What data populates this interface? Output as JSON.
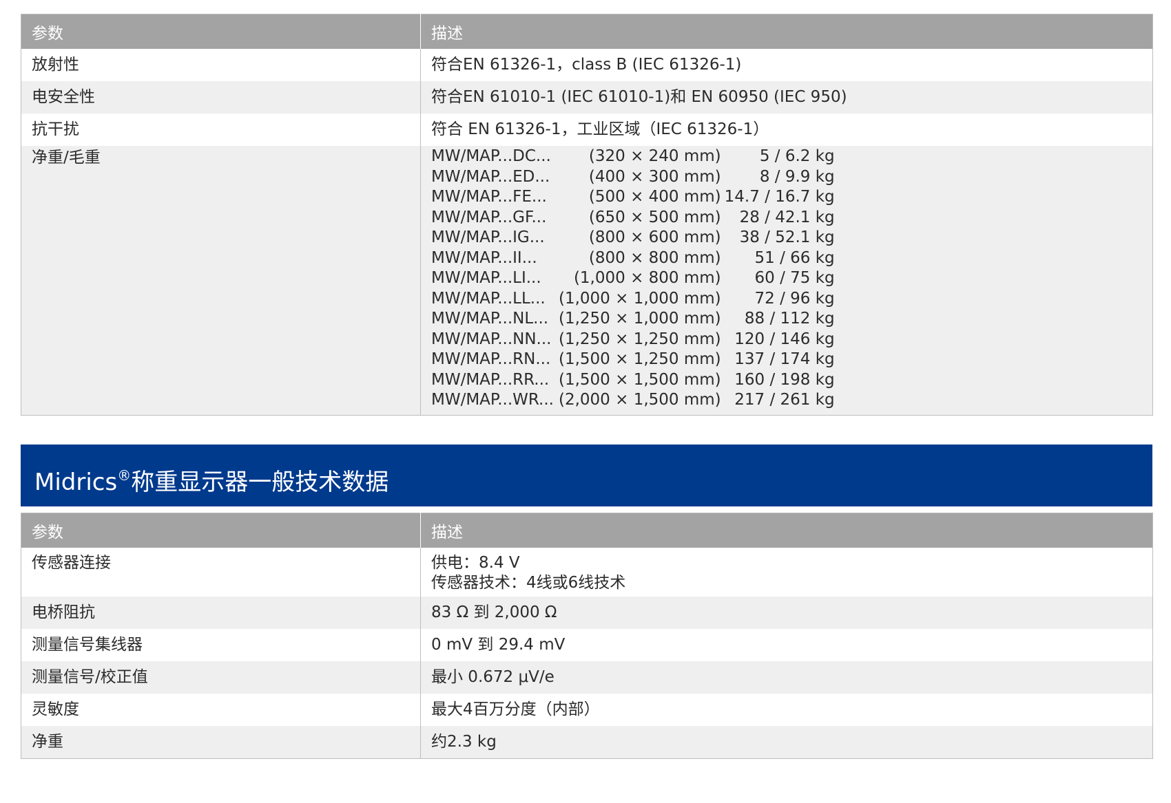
{
  "table1": {
    "headers": {
      "param": "参数",
      "desc": "描述"
    },
    "rows": [
      {
        "param": "放射性",
        "desc": "符合EN 61326-1，class B (IEC 61326-1)"
      },
      {
        "param": "电安全性",
        "desc": "符合EN 61010-1 (IEC 61010-1)和 EN 60950 (IEC 950)"
      },
      {
        "param": "抗干扰",
        "desc": "符合 EN 61326-1，工业区域（IEC 61326-1）"
      },
      {
        "param": "净重/毛重"
      }
    ],
    "weights": [
      {
        "model": "MW/MAP...DC...",
        "dim": "(320 × 240 mm)",
        "weight": "5 / 6.2 kg"
      },
      {
        "model": "MW/MAP...ED...",
        "dim": "(400 × 300 mm)",
        "weight": "8 / 9.9 kg"
      },
      {
        "model": "MW/MAP...FE...",
        "dim": "(500 × 400 mm)",
        "weight": "14.7 / 16.7 kg"
      },
      {
        "model": "MW/MAP...GF...",
        "dim": "(650 × 500 mm)",
        "weight": "28 / 42.1 kg"
      },
      {
        "model": "MW/MAP...IG...",
        "dim": "(800 × 600 mm)",
        "weight": "38 / 52.1 kg"
      },
      {
        "model": "MW/MAP...II...",
        "dim": "(800 × 800 mm)",
        "weight": "51 / 66 kg"
      },
      {
        "model": "MW/MAP...LI...",
        "dim": "(1,000 × 800 mm)",
        "weight": "60 / 75 kg"
      },
      {
        "model": "MW/MAP...LL...",
        "dim": "(1,000 × 1,000 mm)",
        "weight": "72 / 96 kg"
      },
      {
        "model": "MW/MAP...NL...",
        "dim": "(1,250 × 1,000 mm)",
        "weight": "88 / 112 kg"
      },
      {
        "model": "MW/MAP...NN...",
        "dim": "(1,250 × 1,250 mm)",
        "weight": "120 / 146 kg"
      },
      {
        "model": "MW/MAP...RN...",
        "dim": "(1,500 × 1,250 mm)",
        "weight": "137 / 174 kg"
      },
      {
        "model": "MW/MAP...RR...",
        "dim": "(1,500 × 1,500 mm)",
        "weight": "160 / 198 kg"
      },
      {
        "model": "MW/MAP...WR...",
        "dim": "(2,000 × 1,500 mm)",
        "weight": "217 / 261 kg"
      }
    ]
  },
  "section2": {
    "title_prefix": "Midrics",
    "title_mark": "®",
    "title_suffix": "称重显示器一般技术数据"
  },
  "table2": {
    "headers": {
      "param": "参数",
      "desc": "描述"
    },
    "rows": [
      {
        "param": "传感器连接",
        "desc_lines": [
          "供电：8.4 V",
          "传感器技术：4线或6线技术"
        ]
      },
      {
        "param": "电桥阻抗",
        "desc": "83 Ω 到 2,000 Ω"
      },
      {
        "param": "测量信号集线器",
        "desc": "0 mV 到 29.4 mV"
      },
      {
        "param": "测量信号/校正值",
        "desc": "最小 0.672 μV/e"
      },
      {
        "param": "灵敏度",
        "desc": "最大4百万分度（内部）"
      },
      {
        "param": "净重",
        "desc": "约2.3 kg"
      }
    ]
  },
  "colors": {
    "header_gray": "#a3a3a3",
    "row_alt": "#efefef",
    "banner_blue": "#003a8d",
    "text": "#2b2b2b"
  }
}
